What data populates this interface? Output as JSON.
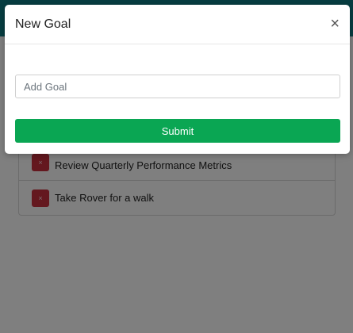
{
  "modal": {
    "title": "New Goal",
    "close_label": "×",
    "input_placeholder": "Add Goal",
    "input_value": "",
    "submit_label": "Submit"
  },
  "goals": [
    {
      "text": "Review Quarterly Performance Metrics",
      "delete_label": "×"
    },
    {
      "text": "Take Rover for a walk",
      "delete_label": "×"
    }
  ],
  "colors": {
    "topbar": "#0f7b83",
    "submit": "#0aa653",
    "delete": "#c8303f"
  }
}
